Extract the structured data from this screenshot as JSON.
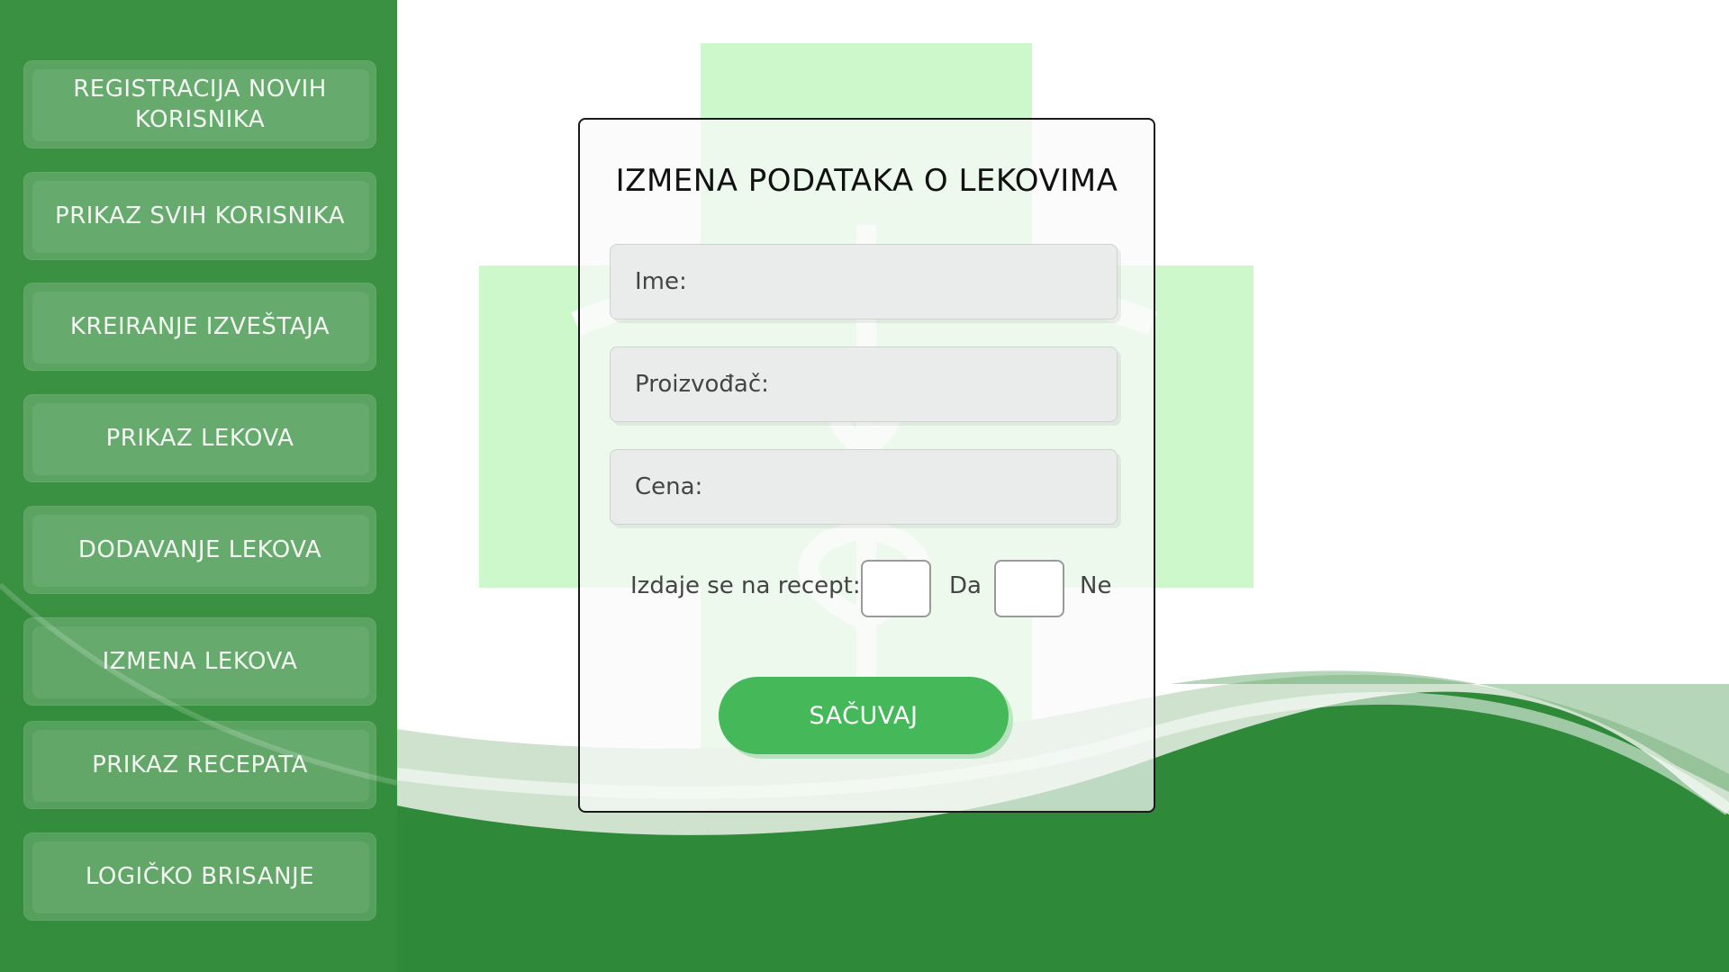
{
  "sidebar": {
    "items": [
      {
        "label": "REGISTRACIJA NOVIH KORISNIKA"
      },
      {
        "label": "PRIKAZ SVIH KORISNIKA"
      },
      {
        "label": "KREIRANJE IZVEŠTAJA"
      },
      {
        "label": "PRIKAZ LEKOVA"
      },
      {
        "label": "DODAVANJE LEKOVA"
      },
      {
        "label": "IZMENA LEKOVA"
      },
      {
        "label": "PRIKAZ RECEPATA"
      },
      {
        "label": "LOGIČKO BRISANJE"
      }
    ]
  },
  "form": {
    "title": "IZMENA PODATAKA O LEKOVIMA",
    "fields": {
      "name": "Ime:",
      "manufacturer": "Proizvođač:",
      "price": "Cena:"
    },
    "prescription_label": "Izdaje se na recept:",
    "option_yes": "Da",
    "option_no": "Ne",
    "save_label": "SAČUVAJ"
  },
  "colors": {
    "sidebar": "#3a9142",
    "wave": "#2e8a39",
    "button": "#45b85a",
    "cross": "#ccf8cc"
  },
  "icons": [
    "pharmacy-cross-icon",
    "caduceus-icon"
  ]
}
